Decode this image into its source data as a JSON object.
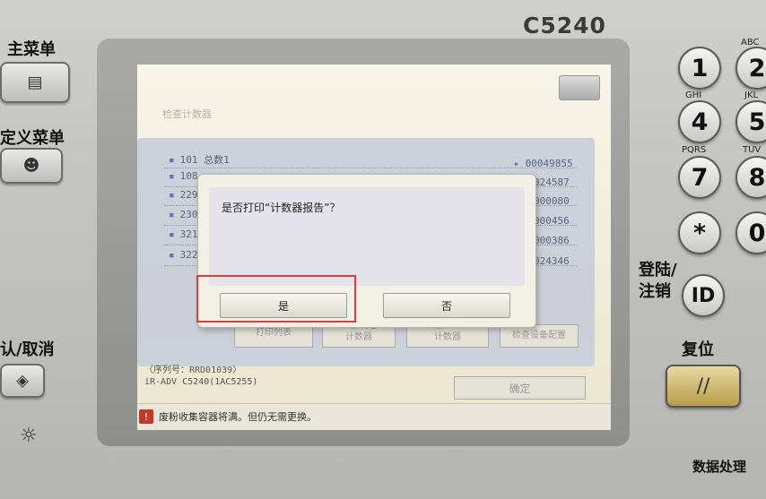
{
  "device": {
    "model": "C5240",
    "left_buttons": {
      "main_menu": "主菜单",
      "custom_menu": "定义菜单",
      "confirm_cancel": "认/取消"
    },
    "keypad": {
      "keys": [
        "1",
        "2",
        "4",
        "5",
        "7",
        "8",
        "*",
        "0"
      ],
      "subs": [
        "ABC",
        "GHI",
        "JKL",
        "PQRS",
        "TUV"
      ]
    },
    "login": "登陆/\n注销",
    "id_key": "ID",
    "reset": "复位",
    "data_processing": "数据处理"
  },
  "screen": {
    "title": "检查计数器",
    "rows": [
      {
        "code": "101",
        "label": "总数1",
        "value": "00049855"
      },
      {
        "code": "108",
        "label": "",
        "value": "024587"
      },
      {
        "code": "229",
        "label": "",
        "value": "000080"
      },
      {
        "code": "230",
        "label": "",
        "value": "000456"
      },
      {
        "code": "321",
        "label": "",
        "value": "000386"
      },
      {
        "code": "322",
        "label": "",
        "value": "024346"
      }
    ],
    "under_buttons": [
      "打印列表",
      "检查发送\n计数器",
      "检查MEAP\n计数器",
      "检查设备配置"
    ],
    "serial_label": "〈序列号：RRD01039〉",
    "model_line": "iR-ADV C5240(1AC5255)",
    "ok_label": "确定",
    "status_message": "废粉收集容器将满。但仍无需更换。",
    "dialog": {
      "message": "是否打印“计数器报告”？",
      "yes": "是",
      "no": "否"
    }
  }
}
